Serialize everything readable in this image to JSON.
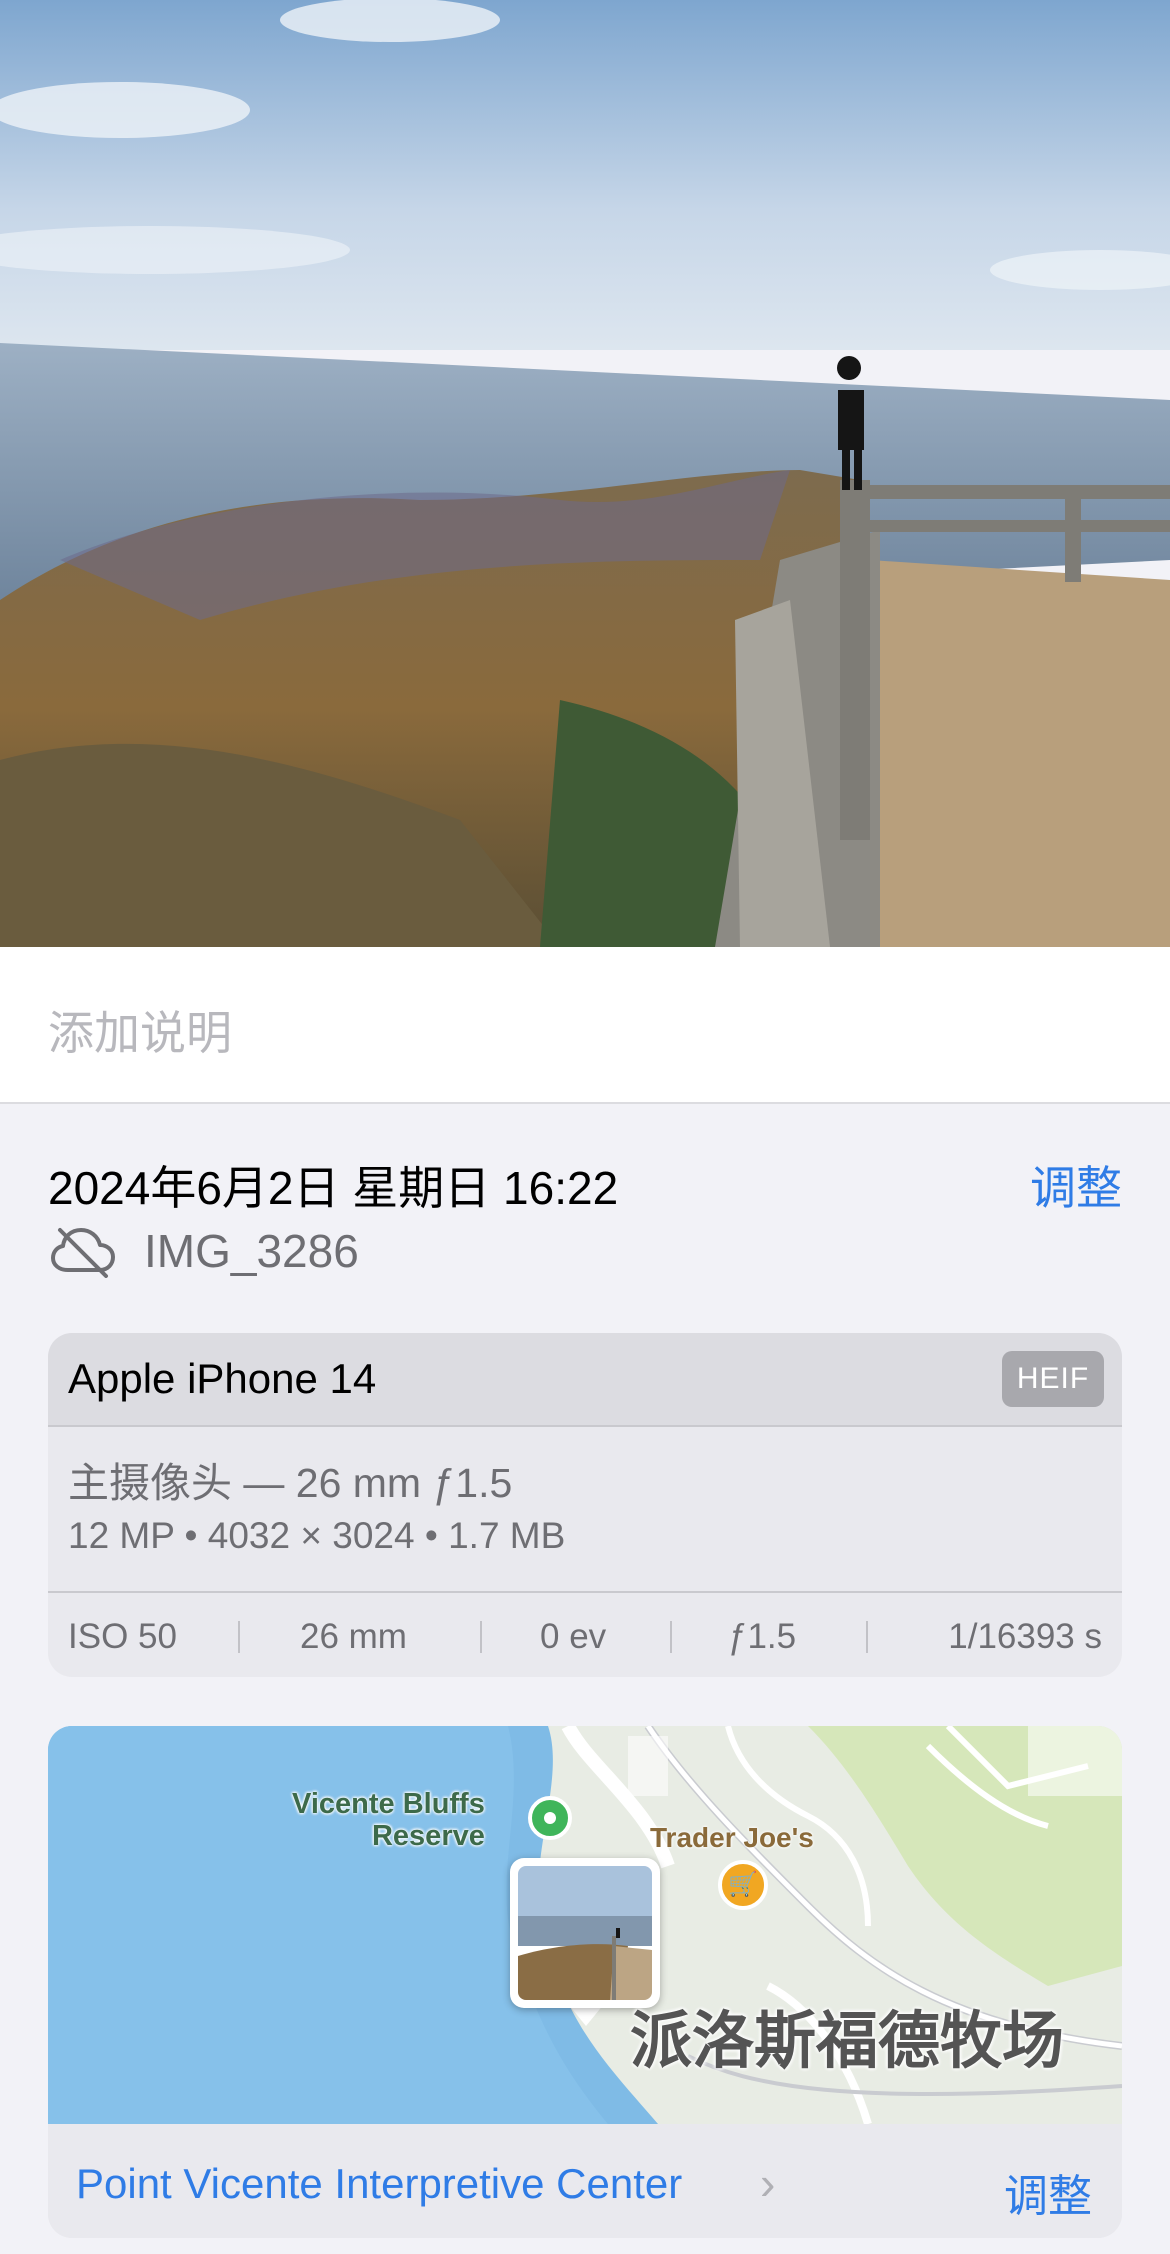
{
  "caption": {
    "placeholder": "添加说明"
  },
  "info": {
    "datetime": "2024年6月2日 星期日 16:22",
    "adjust_label": "调整",
    "filename": "IMG_3286",
    "cloud_icon": "cloud-off-icon"
  },
  "camera": {
    "device": "Apple iPhone 14",
    "format": "HEIF",
    "lens": "主摄像头 — 26 mm ƒ1.5",
    "specs": "12 MP • 4032 × 3024 • 1.7 MB",
    "exif": {
      "iso": "ISO 50",
      "focal": "26 mm",
      "ev": "0 ev",
      "aperture": "ƒ1.5",
      "shutter": "1/16393 s"
    }
  },
  "map": {
    "label_reserve_1": "Vicente Bluffs",
    "label_reserve_2": "Reserve",
    "label_store": "Trader Joe's",
    "label_ranch": "派洛斯福德牧场",
    "place": "Point Vicente Interpretive Center",
    "chevron": "›",
    "adjust_label": "调整"
  },
  "colors": {
    "accent": "#2f7ce6",
    "background": "#f2f2f7"
  }
}
